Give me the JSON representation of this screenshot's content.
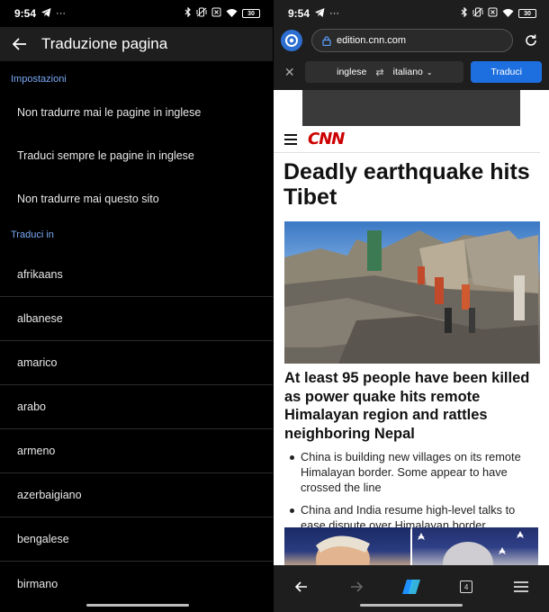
{
  "left": {
    "status": {
      "time": "9:54",
      "battery": "30"
    },
    "appbar": {
      "title": "Traduzione pagina"
    },
    "settings": {
      "header": "Impostazioni",
      "options": [
        "Non tradurre mai le pagine in inglese",
        "Traduci sempre le pagine in inglese",
        "Non tradurre mai questo sito"
      ]
    },
    "languages": {
      "header": "Traduci in",
      "items": [
        "afrikaans",
        "albanese",
        "amarico",
        "arabo",
        "armeno",
        "azerbaigiano",
        "bengalese",
        "birmano"
      ]
    }
  },
  "right": {
    "status": {
      "time": "9:54",
      "battery": "30"
    },
    "urlbar": {
      "url": "edition.cnn.com"
    },
    "translate_bar": {
      "source_lang": "inglese",
      "target_lang": "italiano",
      "button": "Traduci"
    },
    "page": {
      "logo": "CNN",
      "headline": "Deadly earthquake hits Tibet",
      "subhead": "At least 95 people have been killed as power quake hits remote Himalayan region and rattles neighboring Nepal",
      "bullets": [
        "China is building new villages on its remote Himalayan border. Some appear to have crossed the line",
        "China and India resume high-level talks to ease dispute over Himalayan border"
      ]
    },
    "bottom_nav": {
      "tab_count": "4"
    }
  },
  "colors": {
    "accent_blue": "#1d6fe0",
    "section_header": "#7aaaf5",
    "cnn_red": "#cc0000",
    "dark_surface": "#1e1e1e"
  },
  "icons": {
    "status_left": [
      "telegram-icon",
      "more-icon"
    ],
    "status_right": [
      "bluetooth-icon",
      "vibrate-icon",
      "no-sim-icon",
      "wifi-icon",
      "battery-icon"
    ],
    "appbar": "arrow-back-icon",
    "browser": [
      "edge-logo-icon",
      "lock-icon",
      "reload-icon",
      "close-icon",
      "swap-icon",
      "chevron-down-icon"
    ],
    "bottom_nav": [
      "back-icon",
      "forward-icon",
      "copilot-icon",
      "tabs-icon",
      "menu-icon"
    ]
  }
}
